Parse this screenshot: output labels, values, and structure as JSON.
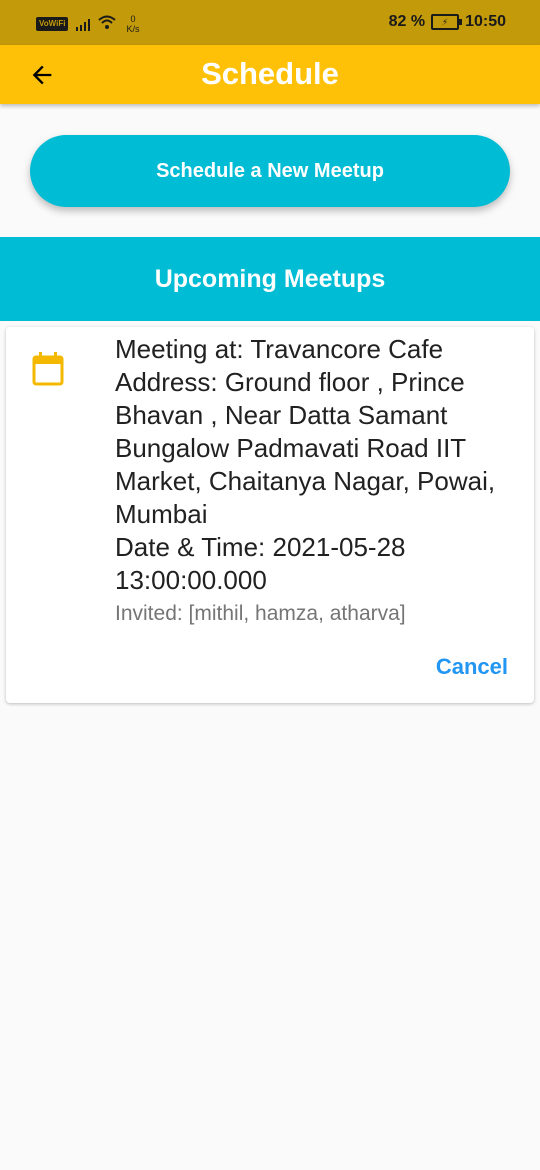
{
  "status_bar": {
    "carrier_badge": "VoWiFi",
    "speed_value": "0",
    "speed_unit": "K/s",
    "battery_percent": "82 %",
    "time": "10:50"
  },
  "app_bar": {
    "title": "Schedule",
    "back_icon": "arrow-left-icon"
  },
  "actions": {
    "schedule_new_label": "Schedule a New Meetup"
  },
  "section": {
    "title": "Upcoming Meetups"
  },
  "meetups": [
    {
      "icon": "calendar-icon",
      "meeting_line": "Meeting at: Travancore Cafe",
      "address_line": "Address: Ground floor , Prince Bhavan , Near Datta Samant Bungalow Padmavati Road IIT Market, Chaitanya Nagar, Powai, Mumbai",
      "datetime_line": "Date & Time: 2021-05-28 13:00:00.000",
      "invited_line": "Invited: [mithil, hamza, atharva]",
      "cancel_label": "Cancel"
    }
  ],
  "colors": {
    "status_bar": "#c29a0a",
    "app_bar": "#ffc107",
    "accent": "#00bcd4",
    "link": "#2196f3"
  }
}
